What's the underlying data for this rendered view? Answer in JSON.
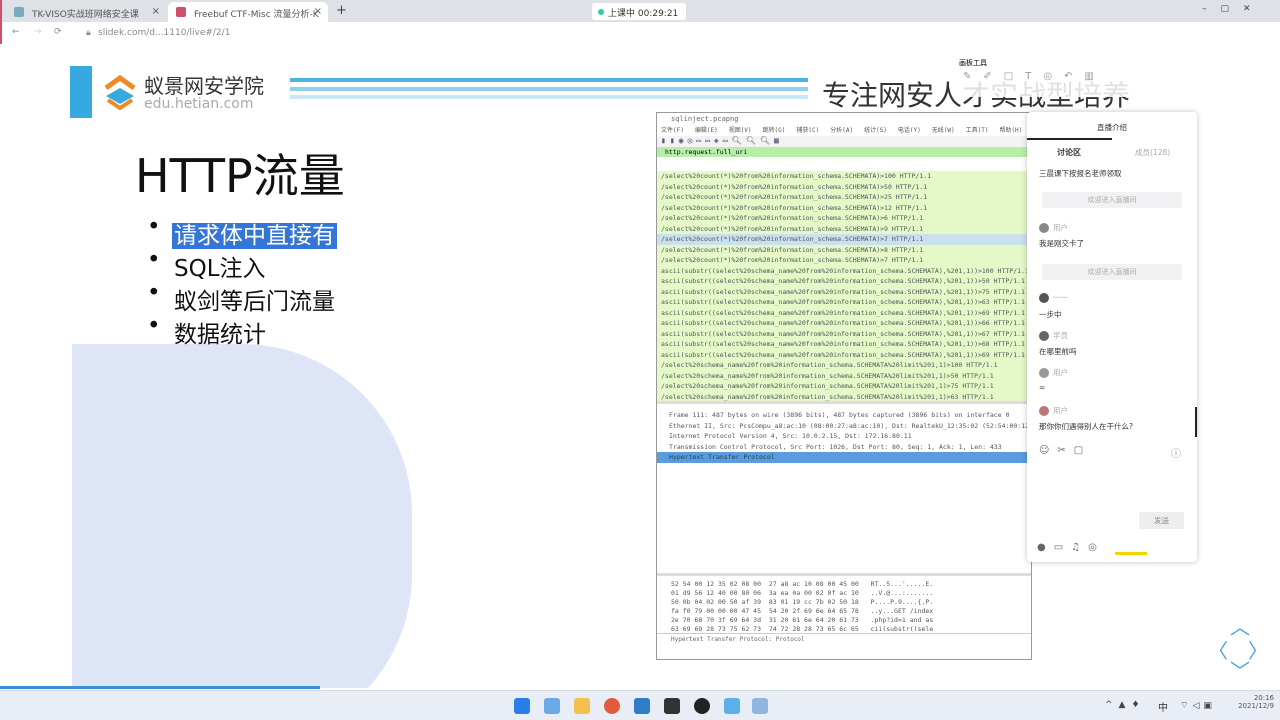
{
  "browser": {
    "tabs": [
      {
        "label": "TK-VISO实战班网络安全课"
      },
      {
        "label": "Freebuf CTF-Misc 流量分析-K"
      }
    ],
    "new_tab": "+",
    "timer": "上课中 00:29:21",
    "url": "slidek.com/d...1110/live#/2/1"
  },
  "slide": {
    "logo_name": "蚁景网安学院",
    "logo_url": "edu.hetian.com",
    "slogan": "专注网安人才实战型培养",
    "title": "HTTP流量",
    "bullets": [
      "请求体中直接有",
      "SQL注入",
      "蚁剑等后门流量",
      "数据统计"
    ]
  },
  "wireshark": {
    "title": "sqlinject.pcapng",
    "menu": [
      "文件(F)",
      "编辑(E)",
      "视图(V)",
      "跳转(G)",
      "捕获(C)",
      "分析(A)",
      "统计(S)",
      "电话(Y)",
      "无线(W)",
      "工具(T)",
      "帮助(H)"
    ],
    "filter": "http.request.full_uri",
    "rows": [
      "/select%20count(*)%20from%20information_schema.SCHEMATA)>100 HTTP/1.1",
      "/select%20count(*)%20from%20information_schema.SCHEMATA)>50 HTTP/1.1",
      "/select%20count(*)%20from%20information_schema.SCHEMATA)>25 HTTP/1.1",
      "/select%20count(*)%20from%20information_schema.SCHEMATA)>12 HTTP/1.1",
      "/select%20count(*)%20from%20information_schema.SCHEMATA)>6 HTTP/1.1",
      "/select%20count(*)%20from%20information_schema.SCHEMATA)>9 HTTP/1.1",
      "/select%20count(*)%20from%20information_schema.SCHEMATA)>7 HTTP/1.1",
      "/select%20count(*)%20from%20information_schema.SCHEMATA)>8 HTTP/1.1",
      "/select%20count(*)%20from%20information_schema.SCHEMATA)>7 HTTP/1.1",
      "ascii(substr((select%20schema_name%20from%20information_schema.SCHEMATA),%201,1))>100 HTTP/1.1",
      "ascii(substr((select%20schema_name%20from%20information_schema.SCHEMATA),%201,1))>50 HTTP/1.1",
      "ascii(substr((select%20schema_name%20from%20information_schema.SCHEMATA),%201,1))>75 HTTP/1.1",
      "ascii(substr((select%20schema_name%20from%20information_schema.SCHEMATA),%201,1))>63 HTTP/1.1",
      "ascii(substr((select%20schema_name%20from%20information_schema.SCHEMATA),%201,1))>69 HTTP/1.1",
      "ascii(substr((select%20schema_name%20from%20information_schema.SCHEMATA),%201,1))>66 HTTP/1.1",
      "ascii(substr((select%20schema_name%20from%20information_schema.SCHEMATA),%201,1))>67 HTTP/1.1",
      "ascii(substr((select%20schema_name%20from%20information_schema.SCHEMATA),%201,1))>68 HTTP/1.1",
      "ascii(substr((select%20schema_name%20from%20information_schema.SCHEMATA),%201,1))>69 HTTP/1.1",
      "/select%20schema_name%20from%20information_schema.SCHEMATA%20limit%201,1)>100 HTTP/1.1",
      "/select%20schema_name%20from%20information_schema.SCHEMATA%20limit%201,1)>50 HTTP/1.1",
      "/select%20schema_name%20from%20information_schema.SCHEMATA%20limit%201,1)>75 HTTP/1.1",
      "/select%20schema_name%20from%20information_schema.SCHEMATA%20limit%201,1)>63 HTTP/1.1"
    ],
    "details": [
      "Frame 111: 487 bytes on wire (3896 bits), 487 bytes captured (3896 bits) on interface 0",
      "Ethernet II, Src: PcsCompu_a8:ac:10 (08:00:27:a8:ac:10), Dst: RealtekU_12:35:02 (52:54:00:12:35:02)",
      "Internet Protocol Version 4, Src: 10.0.2.15, Dst: 172.16.80.11",
      "Transmission Control Protocol, Src Port: 1026, Dst Port: 80, Seq: 1, Ack: 1, Len: 433",
      "Hypertext Transfer Protocol"
    ],
    "hex": [
      "52 54 00 12 35 02 08 00  27 a8 ac 10 08 00 45 00   RT..5...'.....E.",
      "01 d9 56 12 40 00 80 06  3a ea 0a 00 02 0f ac 10   ..V.@...:.......",
      "50 0b 04 02 00 50 af 39  83 01 19 cc 7b 02 50 18   P....P.9....{.P.",
      "fa f0 79 00 00 00 47 45  54 20 2f 69 6e 64 65 78   ..y...GET /index",
      "2e 70 68 70 3f 69 64 3d  31 20 61 6e 64 20 61 73   .php?id=1 and as",
      "63 69 69 28 73 75 62 73  74 72 28 28 73 65 6c 65   cii(substr((sele"
    ],
    "status": "Hypertext Transfer Protocol: Protocol"
  },
  "annotation": {
    "title": "画板工具"
  },
  "chat": {
    "intro_tab": "直播介绍",
    "tab_discuss": "讨论区",
    "tab_members": "成员(128)",
    "messages": [
      {
        "user": "",
        "text": "三晨课下按报名老师领取"
      },
      {
        "user": "用户",
        "text": "我是刚交卡了"
      },
      {
        "user": "一一",
        "text": "一步中"
      },
      {
        "user": "学员",
        "text": "在哪里前吗"
      },
      {
        "user": "用户",
        "text": "="
      },
      {
        "user": "用户",
        "text": "那你你们遇得别人在干什么?"
      }
    ],
    "notices": [
      "欢迎进入直播间",
      "欢迎进入直播间"
    ],
    "send": "发送"
  },
  "taskbar": {
    "ime": "中",
    "time": "20:16",
    "date": "2021/12/9"
  }
}
